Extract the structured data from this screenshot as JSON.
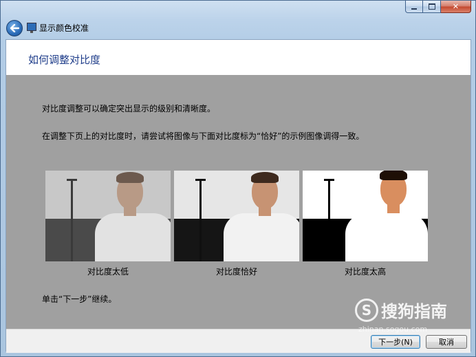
{
  "window": {
    "title": "显示颜色校准",
    "minimize_glyph": "",
    "close_glyph": "✕"
  },
  "page": {
    "heading": "如何调整对比度",
    "para1": "对比度调整可以确定突出显示的级别和清晰度。",
    "para2": "在调整下页上的对比度时，请尝试将图像与下面对比度标为“恰好”的示例图像调得一致。",
    "para3": "单击“下一步”继续。"
  },
  "samples": [
    {
      "label": "对比度太低",
      "colors": {
        "top": "#c8c8c8",
        "bottom": "#4a4a4a",
        "pole": "#3a3a3a",
        "skin": "#b89a86",
        "hair": "#6d5a4e",
        "shirt": "#e2e2e2"
      }
    },
    {
      "label": "对比度恰好",
      "colors": {
        "top": "#e6e6e6",
        "bottom": "#151515",
        "pole": "#101010",
        "skin": "#c79373",
        "hair": "#3e2a1e",
        "shirt": "#f2f2f2"
      }
    },
    {
      "label": "对比度太高",
      "colors": {
        "top": "#ffffff",
        "bottom": "#000000",
        "pole": "#000000",
        "skin": "#d98e5f",
        "hair": "#1e0f06",
        "shirt": "#ffffff"
      }
    }
  ],
  "buttons": {
    "next": "下一步(N)",
    "cancel": "取消"
  },
  "watermark": {
    "logo": "S",
    "brand": "搜狗指南",
    "url": "zhinan.sogou.com"
  },
  "icons": {
    "back": "back-arrow-icon",
    "app": "display-icon"
  }
}
